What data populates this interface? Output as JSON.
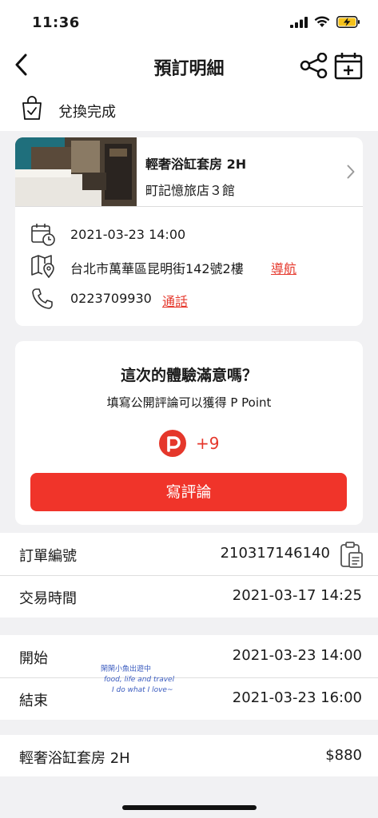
{
  "status_bar": {
    "time": "11:36"
  },
  "header": {
    "title": "預訂明細"
  },
  "exchange": {
    "status": "兌換完成"
  },
  "booking": {
    "room_name": "輕奢浴缸套房 2H",
    "hotel_name": "町記憶旅店３館",
    "checkin_datetime": "2021-03-23 14:00",
    "address": "台北市萬華區昆明街142號2樓",
    "navigate_label": "導航",
    "phone": "0223709930",
    "call_label": "通話"
  },
  "review": {
    "title": "這次的體驗滿意嗎？",
    "subtitle": "填寫公開評論可以獲得 P Point",
    "points": "+9",
    "button_label": "寫評論"
  },
  "order": {
    "number_label": "訂單編號",
    "number_value": "210317146140",
    "time_label": "交易時間",
    "time_value": "2021-03-17 14:25"
  },
  "schedule": {
    "start_label": "開始",
    "start_value": "2021-03-23 14:00",
    "end_label": "結束",
    "end_value": "2021-03-23 16:00"
  },
  "price": {
    "item_label": "輕奢浴缸套房 2H",
    "item_value": "$880"
  },
  "watermark": {
    "line1": "閑閑小魚出遊中",
    "line2": "food, life and travel",
    "line3": "I do what I love~"
  },
  "colors": {
    "accent": "#f0342a",
    "link": "#e5372b",
    "background": "#f1f1f3"
  }
}
